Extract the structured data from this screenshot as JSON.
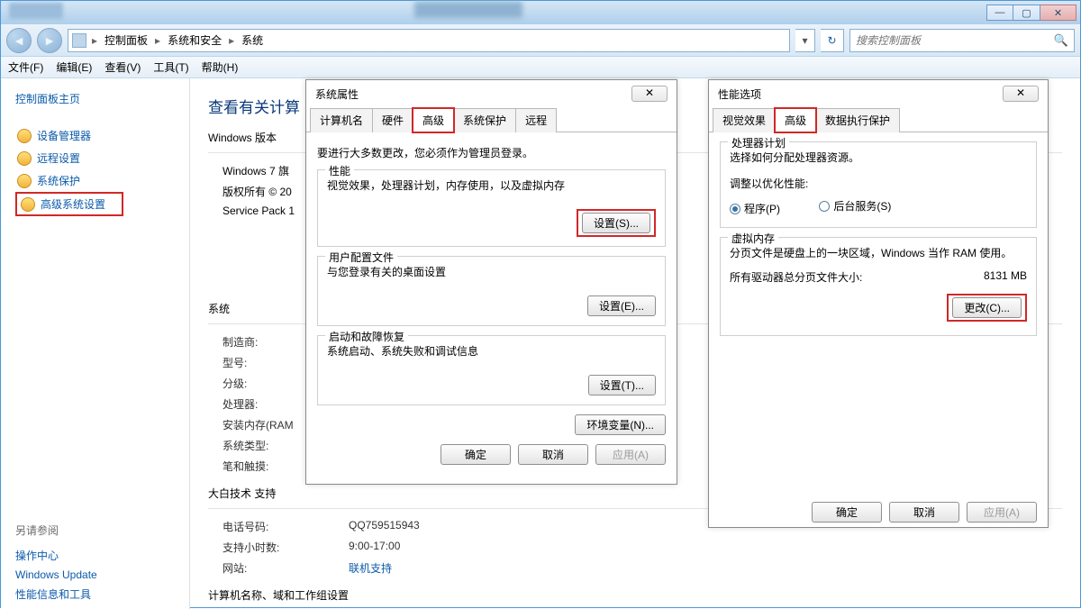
{
  "titlebar": {
    "min": "—",
    "max": "▢",
    "close": "✕"
  },
  "breadcrumb": {
    "items": [
      "控制面板",
      "系统和安全",
      "系统"
    ],
    "sep": "▸",
    "dropdown": "▾",
    "refresh": "↻"
  },
  "search": {
    "placeholder": "搜索控制面板",
    "icon": "🔍"
  },
  "menubar": [
    "文件(F)",
    "编辑(E)",
    "查看(V)",
    "工具(T)",
    "帮助(H)"
  ],
  "sidebar": {
    "home": "控制面板主页",
    "items": [
      {
        "label": "设备管理器",
        "shield": true
      },
      {
        "label": "远程设置",
        "shield": true
      },
      {
        "label": "系统保护",
        "shield": true
      },
      {
        "label": "高级系统设置",
        "shield": true,
        "highlight": true
      }
    ],
    "see_also_title": "另请参阅",
    "see_also": [
      "操作中心",
      "Windows Update",
      "性能信息和工具"
    ]
  },
  "main": {
    "heading": "查看有关计算",
    "section_windows": "Windows 版本",
    "win_edition": "Windows 7 旗",
    "copyright": "版权所有 © 20",
    "sp": "Service Pack 1",
    "section_system": "系统",
    "rows": [
      {
        "label": "制造商:",
        "val": ""
      },
      {
        "label": "型号:",
        "val": ""
      },
      {
        "label": "分级:",
        "val": ""
      },
      {
        "label": "处理器:",
        "val": ""
      },
      {
        "label": "安装内存(RAM",
        "val": ""
      },
      {
        "label": "系统类型:",
        "val": ""
      },
      {
        "label": "笔和触摸:",
        "val": ""
      }
    ],
    "support_title": "大白技术 支持",
    "support_rows": [
      {
        "label": "电话号码:",
        "val": "QQ759515943"
      },
      {
        "label": "支持小时数:",
        "val": "9:00-17:00"
      },
      {
        "label": "网站:",
        "val": "联机支持",
        "link": true
      }
    ],
    "section_computer": "计算机名称、域和工作组设置"
  },
  "sysprops": {
    "title": "系统属性",
    "close": "✕",
    "tabs": [
      "计算机名",
      "硬件",
      "高级",
      "系统保护",
      "远程"
    ],
    "active_tab": 2,
    "admin_note": "要进行大多数更改，您必须作为管理员登录。",
    "perf": {
      "label": "性能",
      "desc": "视觉效果，处理器计划，内存使用，以及虚拟内存",
      "button": "设置(S)..."
    },
    "profiles": {
      "label": "用户配置文件",
      "desc": "与您登录有关的桌面设置",
      "button": "设置(E)..."
    },
    "startup": {
      "label": "启动和故障恢复",
      "desc": "系统启动、系统失败和调试信息",
      "button": "设置(T)..."
    },
    "env_button": "环境变量(N)...",
    "ok": "确定",
    "cancel": "取消",
    "apply": "应用(A)"
  },
  "perfopts": {
    "title": "性能选项",
    "close": "✕",
    "tabs": [
      "视觉效果",
      "高级",
      "数据执行保护"
    ],
    "active_tab": 1,
    "sched": {
      "title": "处理器计划",
      "desc": "选择如何分配处理器资源。",
      "optimize": "调整以优化性能:",
      "opt_program": "程序(P)",
      "opt_bg": "后台服务(S)"
    },
    "vmem": {
      "title": "虚拟内存",
      "desc": "分页文件是硬盘上的一块区域，Windows 当作 RAM 使用。",
      "total_label": "所有驱动器总分页文件大小:",
      "total_val": "8131 MB",
      "change": "更改(C)..."
    },
    "ok": "确定",
    "cancel": "取消",
    "apply": "应用(A)"
  }
}
